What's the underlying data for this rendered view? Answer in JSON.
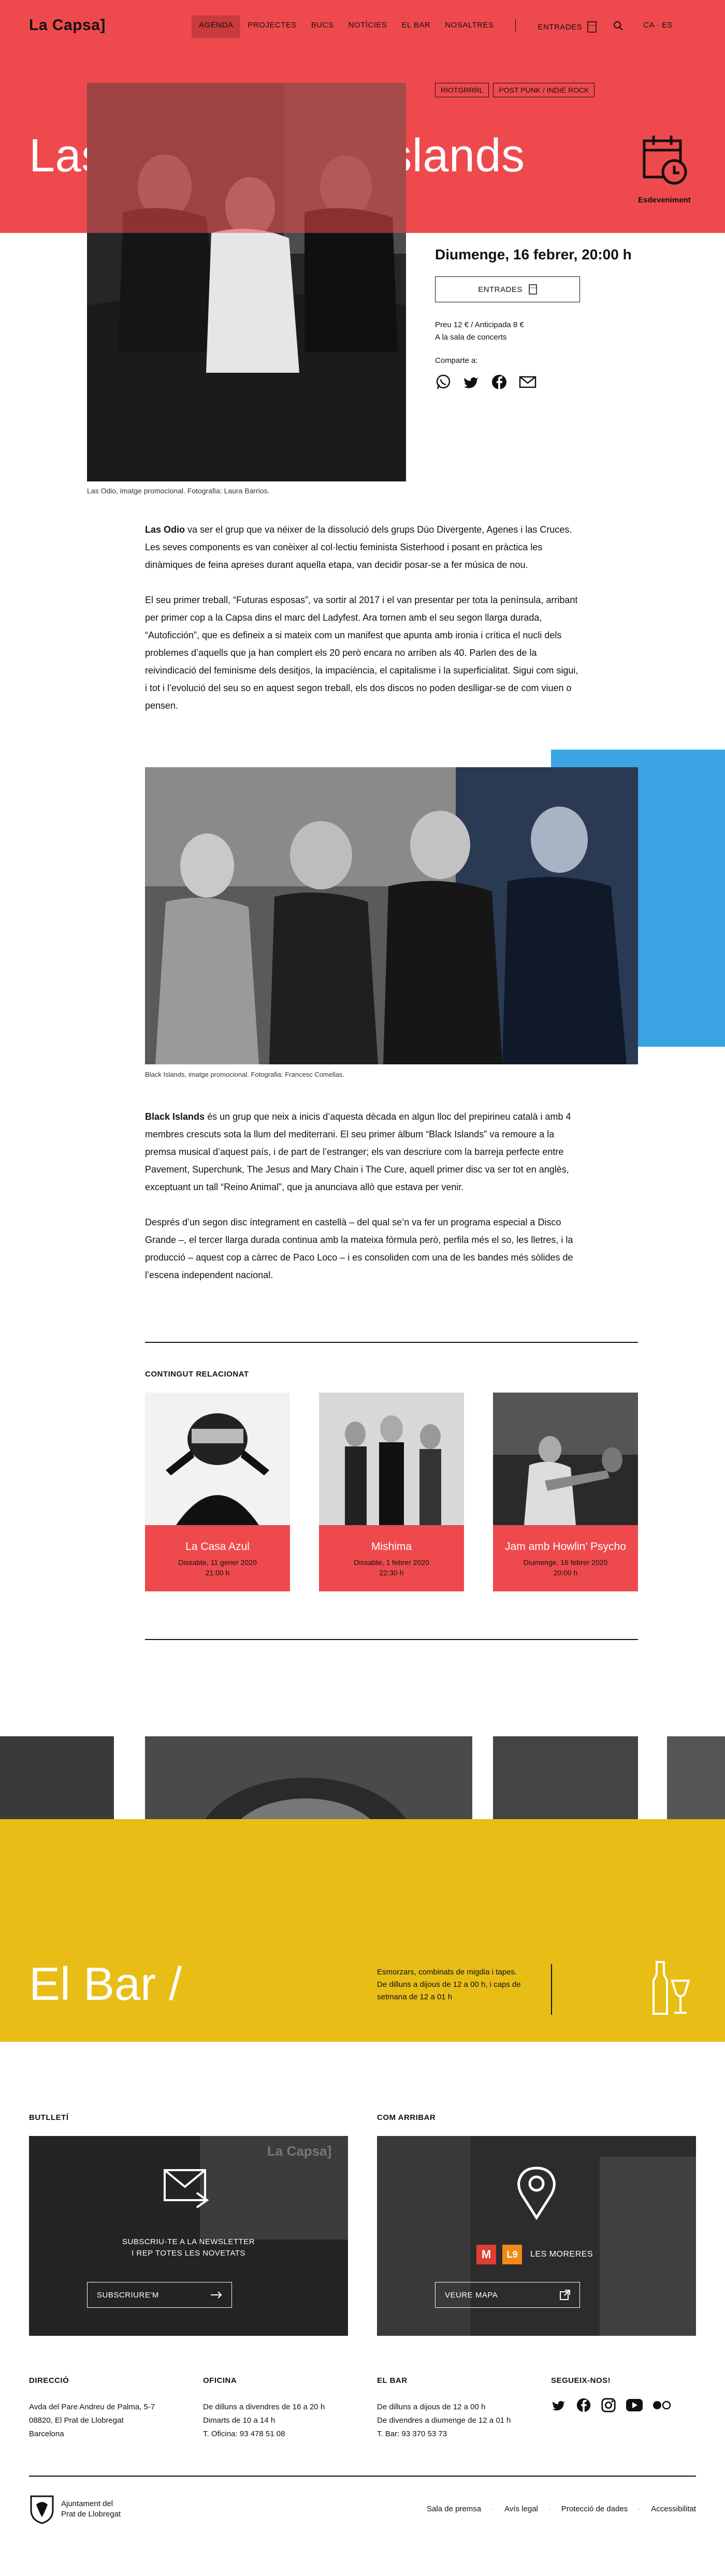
{
  "header": {
    "logo": "La Capsa]",
    "nav": [
      "AGENDA",
      "PROJECTES",
      "BUCS",
      "NOTÍCIES",
      "EL BAR",
      "NOSALTRES"
    ],
    "entrades": "ENTRADES",
    "lang": "CA · ES"
  },
  "hero": {
    "title": "Las odio / Black Islands",
    "event_label": "Esdeveniment",
    "background": "#ee4a4d"
  },
  "event": {
    "tags": [
      "RIOTGRRRL",
      "POST PUNK / INDIE ROCK"
    ],
    "date": "Diumenge, 16 febrer, 20:00 h",
    "tickets_button": "ENTRADES",
    "price_line1": "Preu 12 € / Anticipada 8 €",
    "price_line2": "A la sala de concerts",
    "share_label": "Comparte a:",
    "share_icons": [
      "whatsapp-icon",
      "twitter-icon",
      "facebook-icon",
      "mail-icon"
    ]
  },
  "main_photo_caption": "Las Odio, imatge promocional. Fotografia: Laura Barrios.",
  "body1": {
    "p1_strong": "Las Odio",
    "p1": " va ser el grup que va néixer de la dissolució dels grups Dúo Divergente, Agenes i las Cruces. Les seves components es van conèixer al col·lectiu feminista Sisterhood i posant en pràctica les dinàmiques de feina apreses durant aquella etapa, van decidir posar-se a fer música de nou.",
    "p2": "El seu primer treball, “Futuras esposas”, va sortir al 2017 i el van presentar per tota la península, arribant per primer cop a la Capsa dins el marc del Ladyfest. Ara tornen amb el seu segon llarga durada, “Autoficción”, que es defineix a si mateix com un manifest que apunta amb ironia i crítica el nucli dels problemes d’aquells que ja han complert els 20 però encara no arriben als 40. Parlen des de la reivindicació del feminisme dels desitjos, la impaciència, el capitalisme i la superficialitat. Sigui com sigui, i tot i l’evolució del seu so en aquest segon treball, els dos discos no poden deslligar-se de com viuen o pensen."
  },
  "band_photo_caption": "Black Islands, imatge promocional. Fotografia: Francesc Comellas.",
  "body2": {
    "p1_strong": "Black Islands",
    "p1": " és un grup que neix a inicis d’aquesta dècada en algun lloc del prepirineu català i amb 4 membres crescuts sota la llum del mediterrani. El seu primer àlbum “Black Islands” va remoure a la premsa musical d’aquest país, i de part de l’estranger; els van descriure com la barreja perfecte entre Pavement, Superchunk, The Jesus and Mary Chain i The Cure, aquell primer disc va ser tot en anglès, exceptuant un tall “Reino Animal”, que ja anunciava allò que estava per venir.",
    "p2": "Després d’un segon disc íntegrament en castellà – del qual se’n va fer un programa especial a Disco Grande –, el tercer llarga durada continua amb la mateixa fórmula però, perfila més el so, les lletres, i la producció – aquest cop a càrrec de Paco Loco – i es consoliden com una de les bandes més sòlides de l’escena independent nacional."
  },
  "related": {
    "label": "CONTINGUT RELACIONAT",
    "cards": [
      {
        "title": "La Casa Azul",
        "date": "Dissabte, 11 gener 2020",
        "time": "21:00 h"
      },
      {
        "title": "Mishima",
        "date": "Dissabte, 1 febrer 2020",
        "time": "22:30 h"
      },
      {
        "title": "Jam amb Howlin’ Psycho",
        "date": "Diumenge, 16 febrer 2020",
        "time": "20:00 h"
      }
    ]
  },
  "bar": {
    "title": "El Bar /",
    "description": "Esmorzars, combinats de migdia i tapes. De dilluns a dijous de 12 a 00 h, i caps de setmana de 12 a 01 h",
    "color": "#e8bd16"
  },
  "newsletter": {
    "label": "BUTLLETÍ",
    "text_line1": "SUBSCRIU-TE A LA NEWSLETTER",
    "text_line2": "I REP TOTES LES NOVETATS",
    "button": "SUBSCRIURE'M",
    "sign_text": "La Capsa]"
  },
  "directions": {
    "label": "COM ARRIBAR",
    "metro": "M",
    "line": "L9",
    "station": "LES MORERES",
    "button": "VEURE MAPA"
  },
  "footer": {
    "direccio_title": "DIRECCIÓ",
    "direccio": [
      "Avda del Pare Andreu de Palma, 5-7",
      "08820, El Prat de Llobregat",
      "Barcelona"
    ],
    "oficina_title": "OFICINA",
    "oficina": [
      "De dilluns a divendres de 16 a 20 h",
      "Dimarts de 10 a 14 h",
      "T. Oficina: 93 478 51 08"
    ],
    "bar_title": "EL BAR",
    "bar": [
      "De dilluns a dijous de 12 a 00 h",
      "De divendres a diumenge de 12 a 01 h",
      "T. Bar: 93 370 53 73"
    ],
    "social_title": "SEGUEIX-NOS!",
    "social_icons": [
      "twitter-icon",
      "facebook-icon",
      "instagram-icon",
      "youtube-icon",
      "flickr-icon"
    ],
    "ajuntament_line1": "Ajuntament del",
    "ajuntament_line2": "Prat de Llobregat",
    "links": [
      "Sala de premsa",
      "Avís legal",
      "Protecció de dades",
      "Accessibilitat"
    ]
  }
}
